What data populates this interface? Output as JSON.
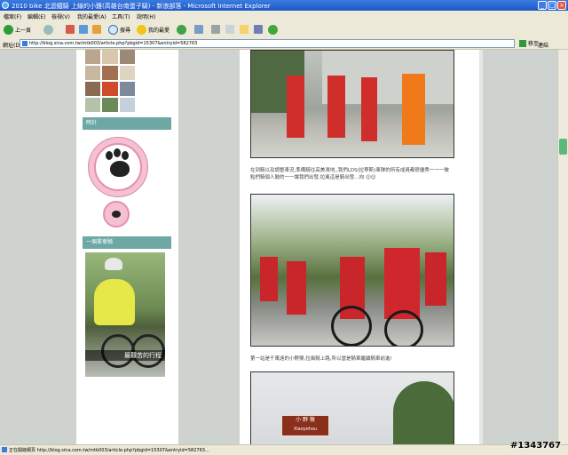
{
  "window": {
    "title": "2010 bike 北迴鐵騎 上線的小雞(高雄台南蛋子騎) - 新浪部落 - Microsoft Internet Explorer"
  },
  "menu": [
    "檔案(F)",
    "編輯(E)",
    "檢視(V)",
    "我的最愛(A)",
    "工具(T)",
    "說明(H)"
  ],
  "toolbar": {
    "back": "上一頁",
    "search": "搜尋",
    "favorites": "我的最愛"
  },
  "address": {
    "label": "網址(D)",
    "url": "http://blog.sina.com.tw/mtb003/article.php?pbgid=15307&entryid=582763",
    "go": "移至",
    "links": "連結"
  },
  "sidebar": {
    "clock_title": "時計",
    "ride_title": "一個單車騎",
    "photo_caption": "最艱苦的行程"
  },
  "main": {
    "caption1": "在到騎以及調整車況,準備騎往高美濕地,,我們LDS(拉蒂斯)車隊的所有成員都很優秀一一一做點們騎個人鼓的一一讓我們出發,拉風這是騎出發…向 ☺☺",
    "caption2": "第一站是千萬遠的小野猴,拉風騎上路,所以當是騎車繼續騎車前進!",
    "sign_text": "小 野 猴",
    "sign_sub": "Xiaoyehou"
  },
  "status": {
    "text": "正在開啟網頁 http://blog.sina.com.tw/mtb003/article.php?pbgid=15307&entryid=582763..."
  },
  "watermark": "#1343767"
}
